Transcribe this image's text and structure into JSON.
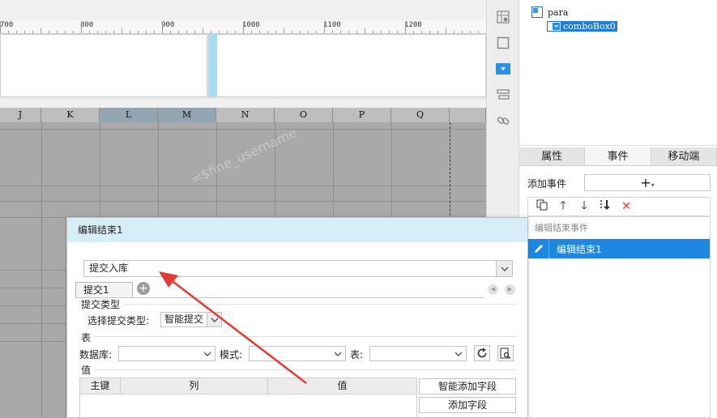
{
  "ruler": {
    "labels": [
      "700",
      "800",
      "900",
      "1000",
      "1100",
      "1200"
    ]
  },
  "grid": {
    "columns": [
      {
        "label": "J",
        "selected": false
      },
      {
        "label": "K",
        "selected": false
      },
      {
        "label": "L",
        "selected": true
      },
      {
        "label": "M",
        "selected": true
      },
      {
        "label": "N",
        "selected": false
      },
      {
        "label": "O",
        "selected": false
      },
      {
        "label": "P",
        "selected": false
      },
      {
        "label": "Q",
        "selected": false
      }
    ],
    "watermark": "=$fine_username"
  },
  "tree": {
    "root": "para",
    "child": "comboBox0"
  },
  "panel_tabs": [
    "属性",
    "事件",
    "移动端"
  ],
  "events": {
    "add_label": "添加事件",
    "add_button": "+",
    "group_label": "编辑结束事件",
    "item_label": "编辑结束1"
  },
  "dialog": {
    "title": "编辑结束1",
    "action_value": "提交入库",
    "sub_tab": "提交1",
    "submit_type_section": "提交类型",
    "submit_type_label": "选择提交类型:",
    "submit_type_value": "智能提交",
    "table_section": "表",
    "database_label": "数据库:",
    "schema_label": "模式:",
    "table_label": "表:",
    "value_section": "值",
    "columns": {
      "key": "主键",
      "column": "列",
      "value": "值"
    },
    "smart_add_button": "智能添加字段",
    "add_field_button": "添加字段"
  },
  "colors": {
    "accent": "#1e87e0",
    "dialog_title_bg": "#d7eef8",
    "arrow": "#e53935",
    "delete": "#e53935"
  }
}
